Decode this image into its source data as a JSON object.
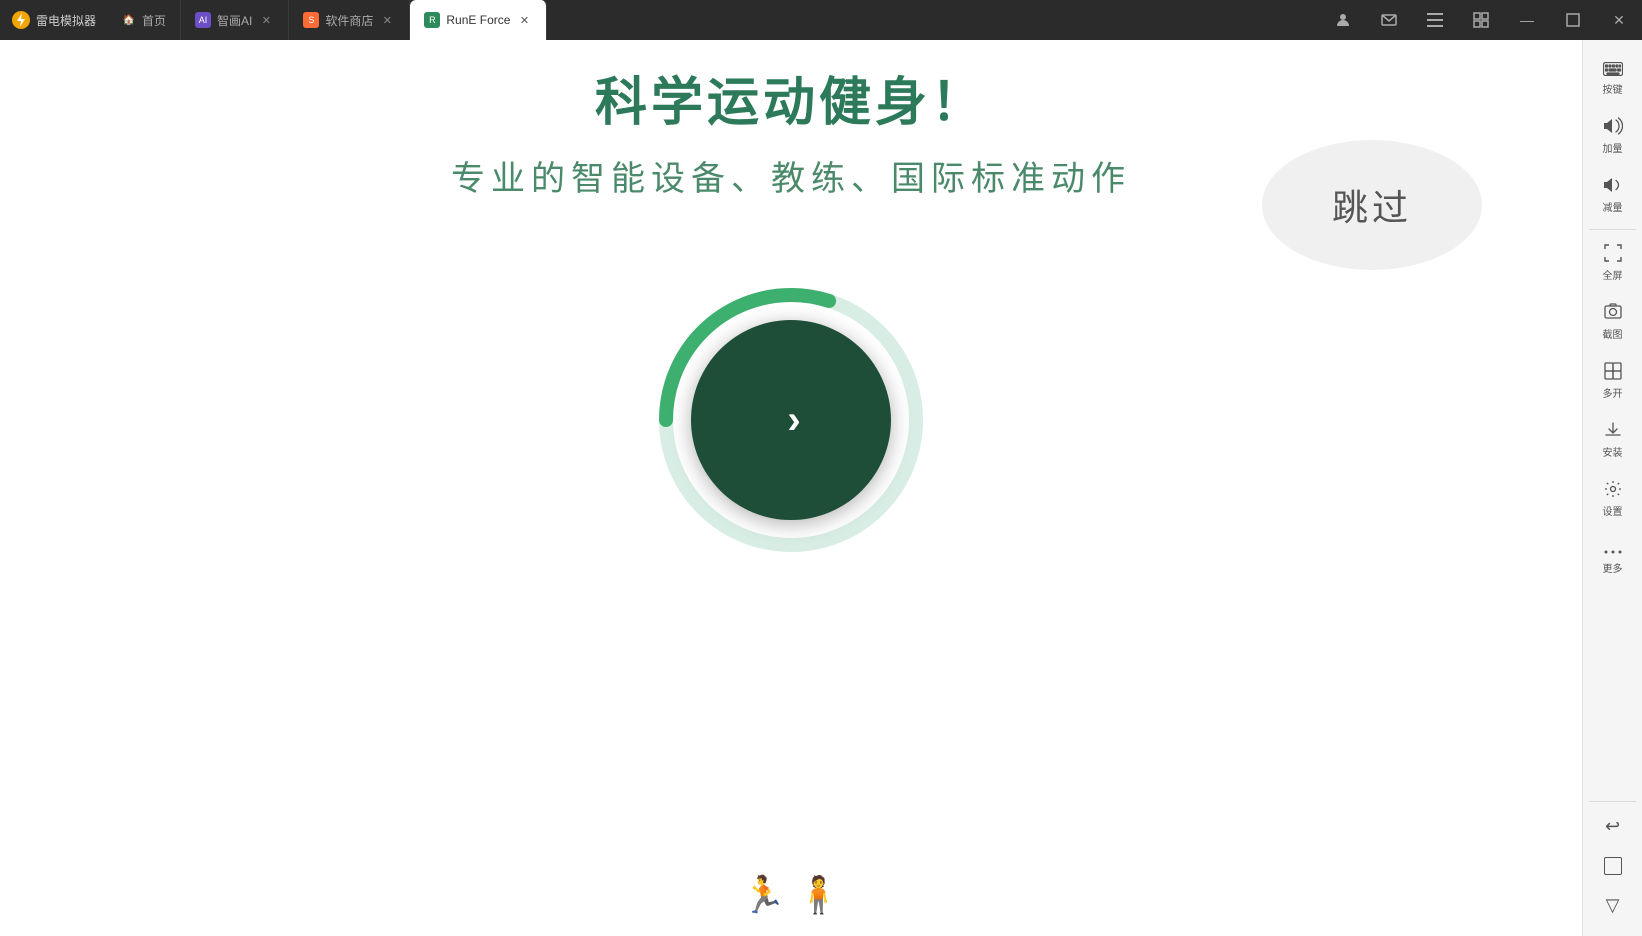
{
  "titlebar": {
    "app_name": "雷电模拟器",
    "tabs": [
      {
        "id": "home",
        "label": "首页",
        "icon": "🏠",
        "active": false,
        "closable": false
      },
      {
        "id": "ai",
        "label": "智画AI",
        "icon": "⚡",
        "active": false,
        "closable": true
      },
      {
        "id": "store",
        "label": "软件商店",
        "icon": "🛍",
        "active": false,
        "closable": true
      },
      {
        "id": "rune",
        "label": "RunE Force",
        "icon": "🟢",
        "active": true,
        "closable": true
      }
    ],
    "window_controls": {
      "user_icon": "👤",
      "mail_icon": "✉",
      "menu_icon": "☰",
      "grid_icon": "⊞",
      "minimize": "—",
      "maximize": "□",
      "close": "✕"
    }
  },
  "main_content": {
    "main_title": "科学运动健身！",
    "sub_title": "专业的智能设备、教练、国际标准动作",
    "skip_button_label": "跳过",
    "next_button_label": "›",
    "progress_percent": 30
  },
  "right_sidebar": {
    "items": [
      {
        "id": "keyboard",
        "icon": "⌨",
        "label": "按键"
      },
      {
        "id": "volume-up",
        "icon": "🔊",
        "label": "加量"
      },
      {
        "id": "volume-down",
        "icon": "🔉",
        "label": "减量"
      },
      {
        "id": "fullscreen",
        "icon": "⛶",
        "label": "全屏"
      },
      {
        "id": "screenshot",
        "icon": "✂",
        "label": "截图"
      },
      {
        "id": "multi",
        "icon": "▶",
        "label": "多开"
      },
      {
        "id": "install",
        "icon": "📦",
        "label": "安装"
      },
      {
        "id": "settings",
        "icon": "⚙",
        "label": "设置"
      },
      {
        "id": "more",
        "icon": "⋯",
        "label": "更多"
      }
    ],
    "bottom_items": [
      {
        "id": "back",
        "icon": "↩",
        "label": ""
      },
      {
        "id": "home",
        "icon": "□",
        "label": ""
      },
      {
        "id": "recent",
        "icon": "▽",
        "label": ""
      }
    ]
  },
  "colors": {
    "accent_green": "#1e4d38",
    "light_green": "#4caf7d",
    "ring_bg": "#d0ece0",
    "ring_progress": "#3daf6e",
    "skip_bg": "#f0f0f0",
    "title_color": "#2d7a5a",
    "subtitle_color": "#4a8a6a"
  }
}
